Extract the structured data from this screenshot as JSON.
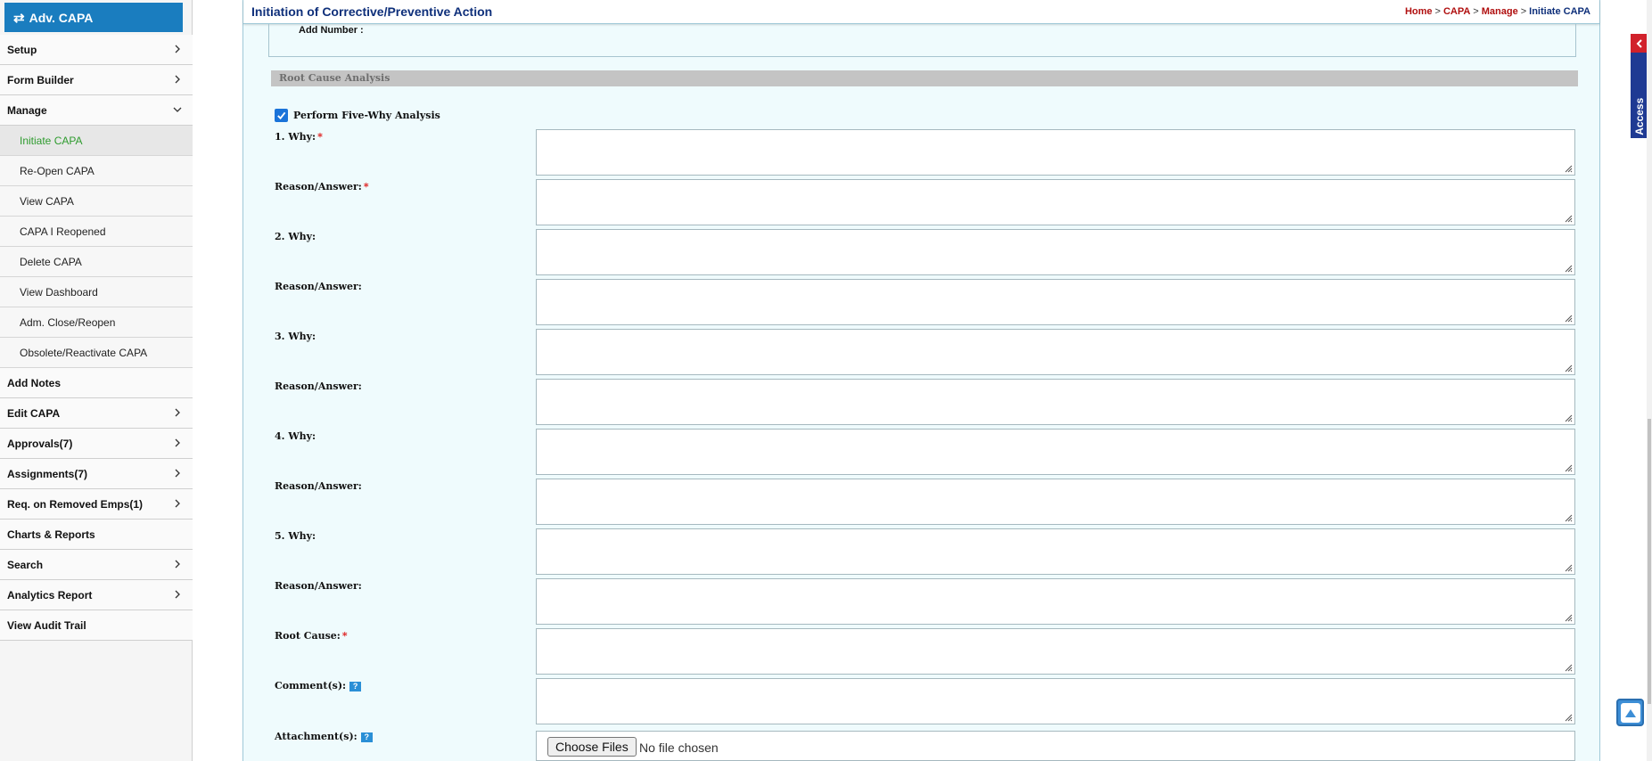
{
  "brand": {
    "label": "Adv. CAPA",
    "icon": "refresh-icon"
  },
  "sidebar": {
    "items": [
      {
        "label": "Setup",
        "has_chevron": true,
        "chevron": "right"
      },
      {
        "label": "Form Builder",
        "has_chevron": true,
        "chevron": "right"
      },
      {
        "label": "Manage",
        "has_chevron": true,
        "chevron": "down"
      },
      {
        "label": "Add Notes",
        "has_chevron": false
      },
      {
        "label": "Edit CAPA",
        "has_chevron": true,
        "chevron": "right"
      },
      {
        "label": "Approvals(7)",
        "has_chevron": true,
        "chevron": "right"
      },
      {
        "label": "Assignments(7)",
        "has_chevron": true,
        "chevron": "right"
      },
      {
        "label": "Req. on Removed Emps(1)",
        "has_chevron": true,
        "chevron": "right"
      },
      {
        "label": "Charts & Reports",
        "has_chevron": false
      },
      {
        "label": "Search",
        "has_chevron": true,
        "chevron": "right"
      },
      {
        "label": "Analytics Report",
        "has_chevron": true,
        "chevron": "right"
      },
      {
        "label": "View Audit Trail",
        "has_chevron": false
      }
    ],
    "manage_sub": [
      {
        "label": "Initiate CAPA",
        "active": true
      },
      {
        "label": "Re-Open CAPA"
      },
      {
        "label": "View CAPA"
      },
      {
        "label": "CAPA I Reopened"
      },
      {
        "label": "Delete CAPA"
      },
      {
        "label": "View Dashboard"
      },
      {
        "label": "Adm. Close/Reopen"
      },
      {
        "label": "Obsolete/Reactivate CAPA"
      }
    ]
  },
  "header": {
    "title": "Initiation of Corrective/Preventive Action",
    "breadcrumb": [
      "Home",
      "CAPA",
      "Manage",
      "Initiate CAPA"
    ],
    "breadcrumb_sep": ">"
  },
  "form": {
    "add_number_label": "Add Number :",
    "section_title": "Root Cause Analysis",
    "five_why": {
      "label": "Perform Five-Why Analysis",
      "checked": true
    },
    "fields": [
      {
        "label": "1. Why:",
        "required": true,
        "value": ""
      },
      {
        "label": "Reason/Answer:",
        "required": true,
        "value": ""
      },
      {
        "label": "2. Why:",
        "required": false,
        "value": ""
      },
      {
        "label": "Reason/Answer:",
        "required": false,
        "value": ""
      },
      {
        "label": "3. Why:",
        "required": false,
        "value": ""
      },
      {
        "label": "Reason/Answer:",
        "required": false,
        "value": ""
      },
      {
        "label": "4. Why:",
        "required": false,
        "value": ""
      },
      {
        "label": "Reason/Answer:",
        "required": false,
        "value": ""
      },
      {
        "label": "5. Why:",
        "required": false,
        "value": ""
      },
      {
        "label": "Reason/Answer:",
        "required": false,
        "value": ""
      },
      {
        "label": "Root Cause:",
        "required": true,
        "value": ""
      },
      {
        "label": "Comment(s):",
        "required": false,
        "help": true,
        "value": ""
      }
    ],
    "required_mark": "*",
    "help_mark": "?",
    "attachment": {
      "label": "Attachment(s):",
      "button": "Choose Files",
      "status": "No file chosen"
    }
  },
  "quick_access": {
    "label": "Quick Access"
  },
  "colors": {
    "brand": "#1a7dbf",
    "active_menu": "#2e9b2e",
    "title": "#0e2f7a",
    "breadcrumb_link": "#b00f0f",
    "required": "#dd1111"
  }
}
